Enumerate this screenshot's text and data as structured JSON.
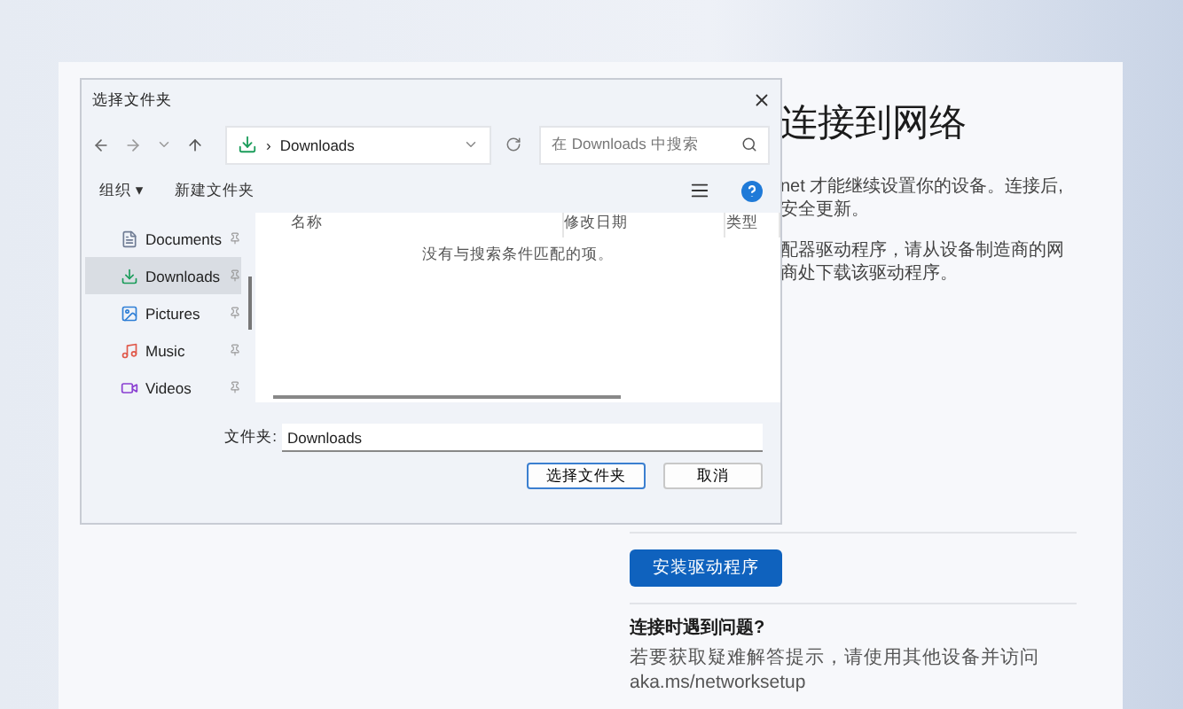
{
  "setup_card": {
    "title": "连接到网络",
    "paragraphs": [
      [
        "net 才能继续设置你的设备。连接后,",
        "安全更新。"
      ],
      [
        "配器驱动程序，请从设备制造商的网",
        "商处下载该驱动程序。"
      ]
    ],
    "install_button": "安装驱动程序",
    "help_heading": "连接时遇到问题?",
    "help_text": "若要获取疑难解答提示，请使用其他设备并访问 aka.ms/networksetup"
  },
  "dialog": {
    "title": "选择文件夹",
    "path_separator": "›",
    "path": "Downloads",
    "search": {
      "placeholder": "在 Downloads 中搜索"
    },
    "toolbar": {
      "organize": "组织 ▾",
      "new_folder": "新建文件夹"
    },
    "sidebar": [
      {
        "label": "Documents",
        "kind": "documents",
        "selected": false
      },
      {
        "label": "Downloads",
        "kind": "downloads",
        "selected": true
      },
      {
        "label": "Pictures",
        "kind": "pictures",
        "selected": false
      },
      {
        "label": "Music",
        "kind": "music",
        "selected": false
      },
      {
        "label": "Videos",
        "kind": "videos",
        "selected": false
      }
    ],
    "columns": [
      "名称",
      "修改日期",
      "类型"
    ],
    "empty_message": "没有与搜索条件匹配的项。",
    "folder_label": "文件夹:",
    "folder_value": "Downloads",
    "buttons": [
      {
        "label": "选择文件夹",
        "kind": "primary"
      },
      {
        "label": "取消",
        "kind": "secondary"
      }
    ]
  }
}
